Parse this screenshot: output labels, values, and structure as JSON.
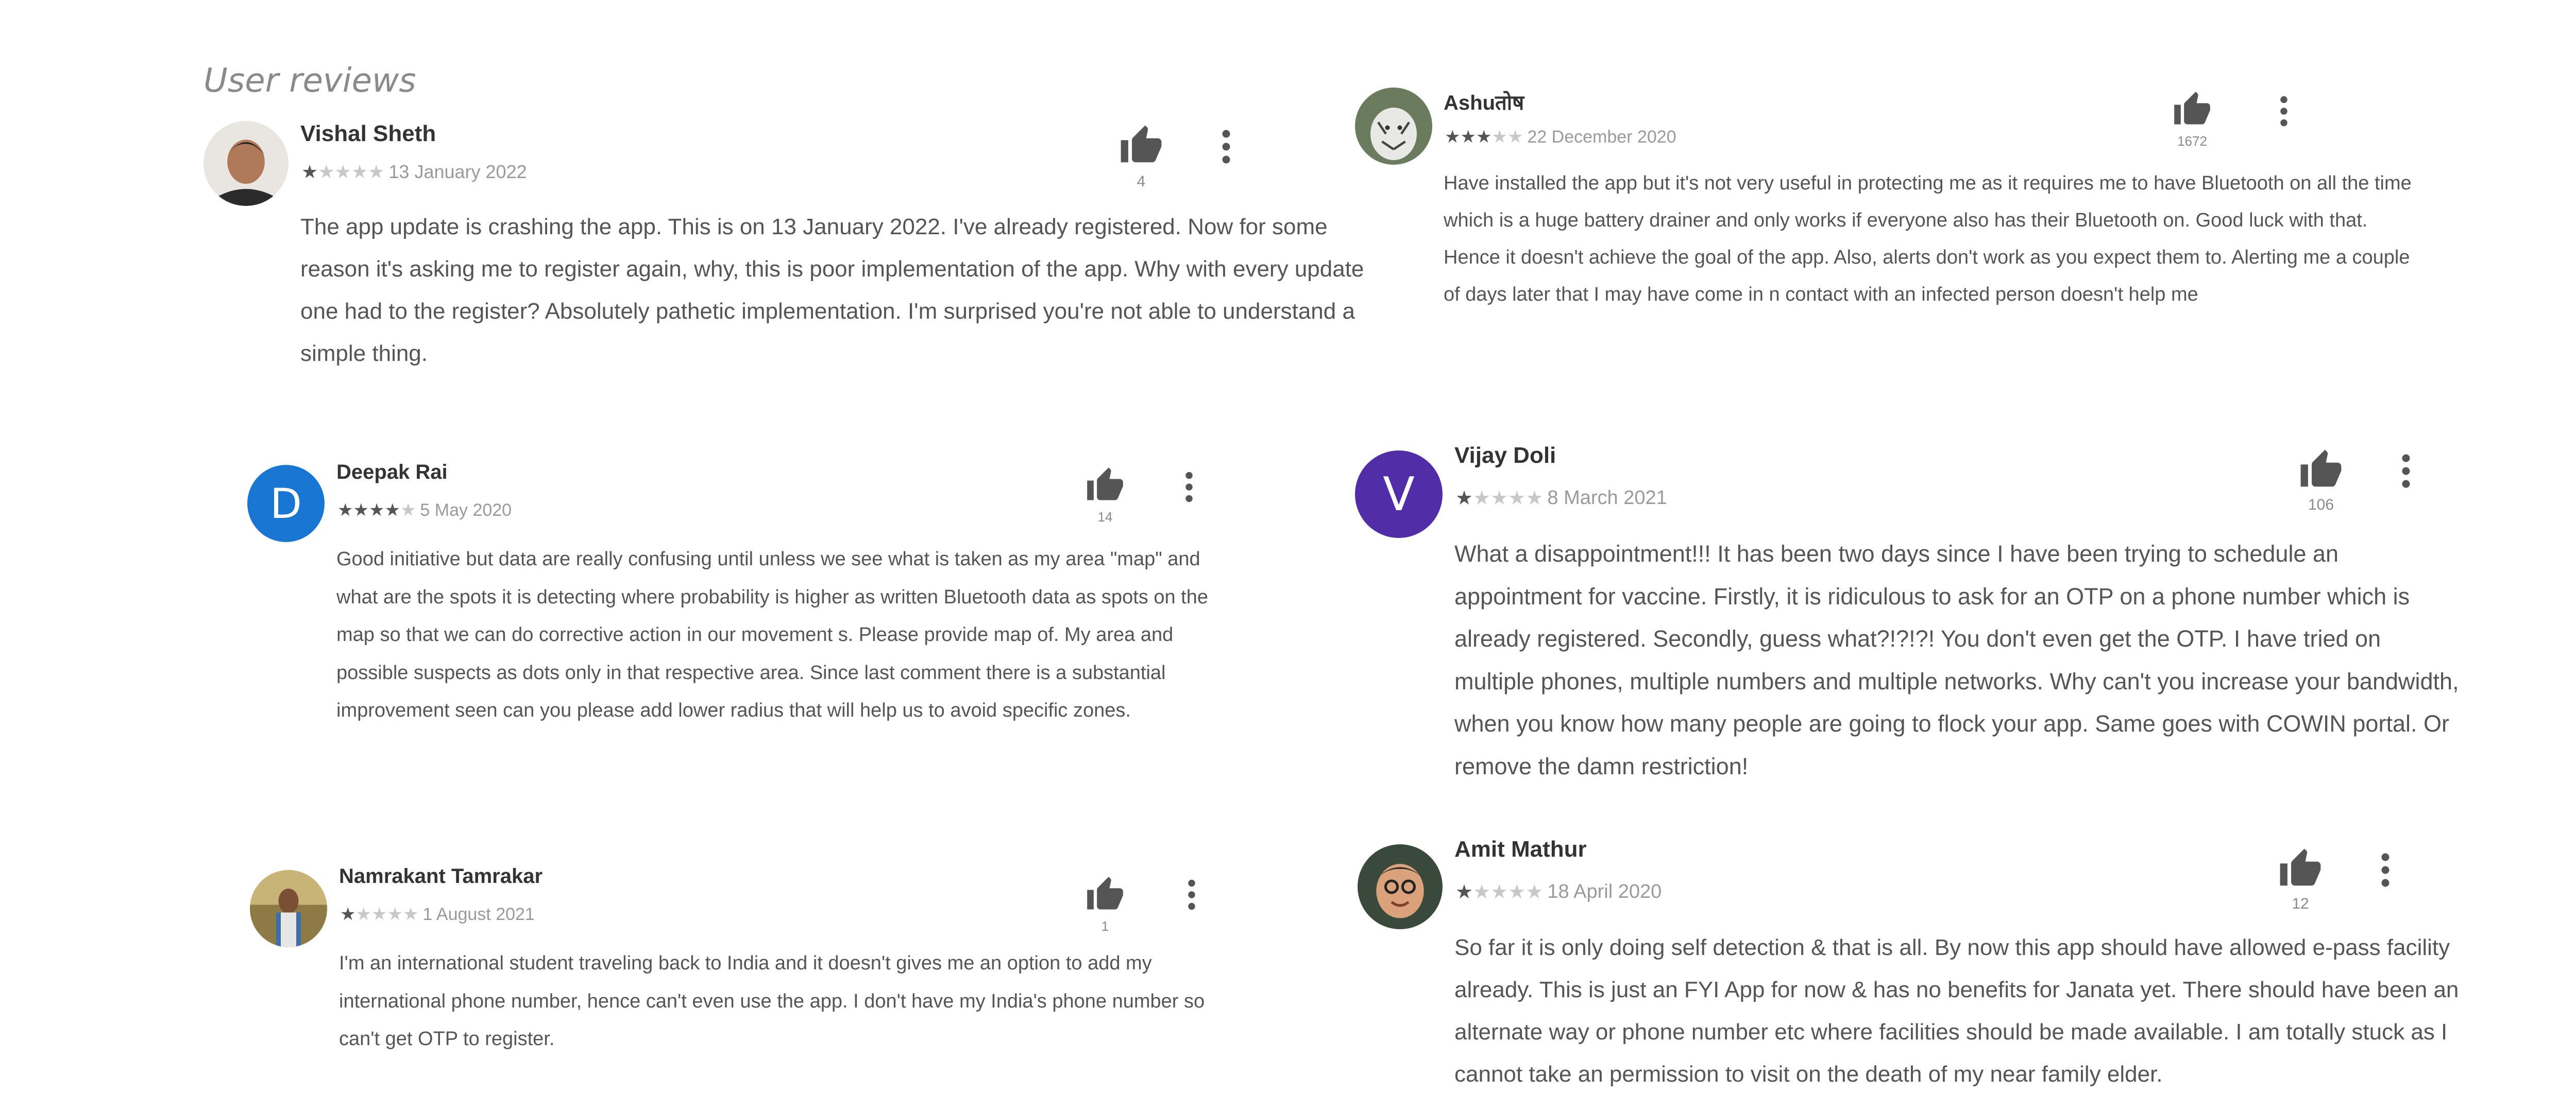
{
  "heading": "User reviews",
  "reviews": [
    {
      "name": "Vishal Sheth",
      "rating": 1,
      "date": "13 January 2022",
      "likes": "4",
      "avatar": "photo-man",
      "text": "The app update is crashing the app. This is on 13 January 2022. I've already registered. Now for some reason it's asking me to register again, why, this is poor implementation of the app. Why with every update one had to the register? Absolutely pathetic implementation. I'm surprised you're not able to understand a simple thing."
    },
    {
      "name": "Ashuतोष",
      "rating": 3,
      "date": "22 December 2020",
      "likes": "1672",
      "avatar": "photo-tiger",
      "text": "Have installed the app but it's not very useful in protecting me as it requires me to have Bluetooth on all the time which is a huge battery drainer and only works if everyone also has their Bluetooth on. Good luck with that. Hence it doesn't achieve the goal of the app. Also, alerts don't work as you expect them to. Alerting me a couple of days later that I may have come in n contact with an infected person doesn't help me"
    },
    {
      "name": "Deepak Rai",
      "rating": 4,
      "date": "5 May 2020",
      "likes": "14",
      "avatar": "letter",
      "letter": "D",
      "avatar_color": "#1976d2",
      "text": "Good initiative but data are really confusing until unless we see what is taken as my area \"map\" and what are the spots it is detecting where probability is higher as written Bluetooth data as spots on the map so that we can do corrective action in our movement s. Please provide map of. My area and possible suspects as dots only in that respective area. Since last comment there is a substantial improvement seen can you please add lower radius that will help us to avoid specific zones."
    },
    {
      "name": "Vijay Doli",
      "rating": 1,
      "date": "8 March 2021",
      "likes": "106",
      "avatar": "letter",
      "letter": "V",
      "avatar_color": "#512da8",
      "text": "What a disappointment!!! It has been two days since I have been trying to schedule an appointment for vaccine. Firstly, it is ridiculous to ask for an OTP on a phone number which is already registered. Secondly, guess what?!?!?! You don't even get the OTP. I have tried on multiple phones, multiple numbers and multiple networks. Why can't you increase your bandwidth, when you know how many people are going to flock your app. Same goes with COWIN portal. Or remove the damn restriction!"
    },
    {
      "name": "Namrakant Tamrakar",
      "rating": 1,
      "date": "1 August 2021",
      "likes": "1",
      "avatar": "photo-outdoor",
      "text": "I'm an international student traveling back to India and it doesn't gives me an option to add my international phone number, hence can't even use the app. I don't have my India's phone number so can't get OTP to register."
    },
    {
      "name": "Amit Mathur",
      "rating": 1,
      "date": "18 April 2020",
      "likes": "12",
      "avatar": "photo-glasses",
      "text": "So far it is only doing self detection & that is all. By now this app should have allowed e-pass facility already. This is just an FYI App for now & has no benefits for Janata yet. There should have been an alternate way or phone number etc where facilities should be made available. I am totally stuck as I cannot take an permission to visit on the death of my near family elder."
    }
  ]
}
